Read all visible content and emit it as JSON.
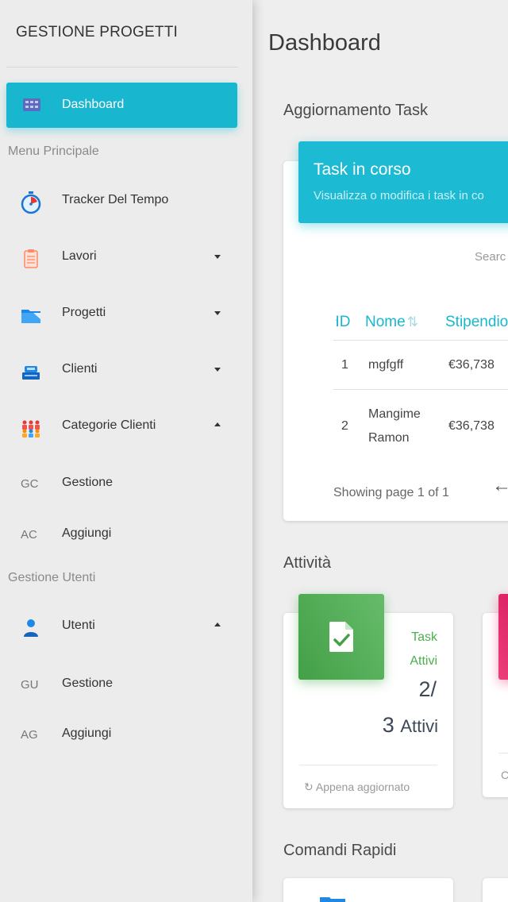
{
  "sidebar": {
    "brand": "GESTIONE PROGETTI",
    "active_item": {
      "label": "Dashboard",
      "icon": "dashboard-icon"
    },
    "section_main": "Menu Principale",
    "items": [
      {
        "label": "Tracker Del Tempo",
        "icon": "stopwatch-icon"
      },
      {
        "label": "Lavori",
        "icon": "clipboard-icon",
        "caret": "down"
      },
      {
        "label": "Progetti",
        "icon": "folder-icon",
        "caret": "down"
      },
      {
        "label": "Clienti",
        "icon": "cash-register-icon",
        "caret": "down"
      },
      {
        "label": "Categorie Clienti",
        "icon": "people-group-icon",
        "caret": "up"
      }
    ],
    "categorie_sub": [
      {
        "abbr": "GC",
        "label": "Gestione"
      },
      {
        "abbr": "AC",
        "label": "Aggiungi"
      }
    ],
    "section_users": "Gestione Utenti",
    "users_item": {
      "label": "Utenti",
      "icon": "user-icon",
      "caret": "up"
    },
    "users_sub": [
      {
        "abbr": "GU",
        "label": "Gestione"
      },
      {
        "abbr": "AG",
        "label": "Aggiungi"
      }
    ]
  },
  "main": {
    "title": "Dashboard",
    "task_section": "Aggiornamento Task",
    "task_card": {
      "title": "Task in corso",
      "subtitle": "Visualizza o modifica i task in co",
      "search_placeholder": "Searc",
      "columns": [
        "ID",
        "Nome",
        "Stipendio"
      ],
      "rows": [
        {
          "id": "1",
          "name_line1": "mgfgff",
          "name_line2": "",
          "salary": "€36,738"
        },
        {
          "id": "2",
          "name_line1": "Mangime",
          "name_line2": "Ramon",
          "salary": "€36,738"
        }
      ],
      "pager": "Showing page 1 of 1"
    },
    "activity_section": "Attività",
    "stat_card": {
      "category_line1": "Task",
      "category_line2": "Attivi",
      "value_line1": "2/",
      "value_number": "3",
      "value_unit": "Attivi",
      "footer": "Appena aggiornato",
      "accent": "#4caf50"
    },
    "stat_card2": {
      "accent": "#e91e63",
      "footer": "C"
    },
    "quick_section": "Comandi Rapidi"
  },
  "colors": {
    "primary": "#00bcd4",
    "success": "#4caf50",
    "danger": "#e91e63"
  }
}
